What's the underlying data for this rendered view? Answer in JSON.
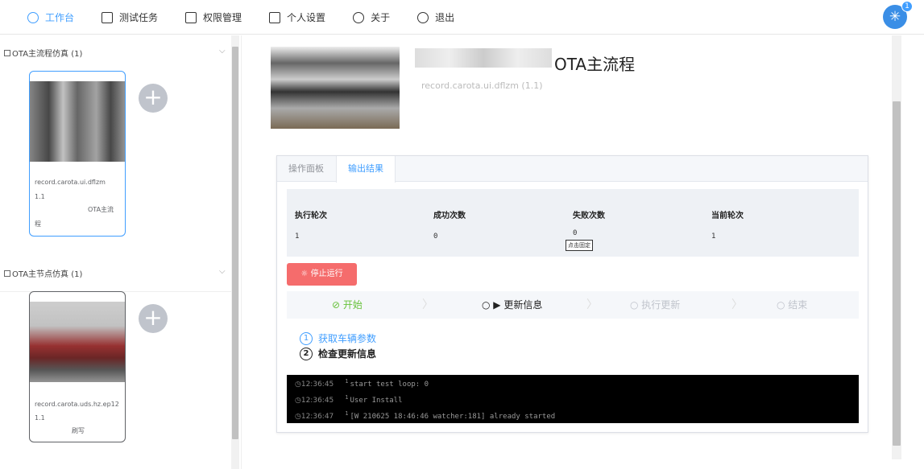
{
  "nav": {
    "items": [
      {
        "label": "工作台"
      },
      {
        "label": "测试任务"
      },
      {
        "label": "权限管理"
      },
      {
        "label": "个人设置"
      },
      {
        "label": "关于"
      },
      {
        "label": "退出"
      }
    ],
    "badge": "1"
  },
  "sidebar": {
    "groups": [
      {
        "title": "OTA主流程仿真 (1)",
        "card": {
          "line1": "record.carota.ui.dflzm",
          "line2": "1.1",
          "line3": "OTA主流",
          "line4": "程"
        }
      },
      {
        "title": "OTA主节点仿真 (1)",
        "card": {
          "line1": "record.carota.uds.hz.ep12",
          "line2": "1.1",
          "line3": "刷写"
        }
      }
    ]
  },
  "main": {
    "title": "OTA主流程",
    "subtitle": "record.carota.ui.dflzm (1.1)",
    "tabs": [
      {
        "label": "操作面板"
      },
      {
        "label": "输出结果"
      }
    ],
    "stats": {
      "headers": [
        "执行轮次",
        "成功次数",
        "失败次数",
        "当前轮次"
      ],
      "values": [
        "1",
        "0",
        "0",
        "1"
      ],
      "tooltip": "点击固定"
    },
    "stop_button": "停止运行",
    "steps": [
      {
        "label": "开始",
        "state": "done"
      },
      {
        "label": "更新信息",
        "state": "current"
      },
      {
        "label": "执行更新",
        "state": "wait"
      },
      {
        "label": "结束",
        "state": "wait"
      }
    ],
    "substeps": [
      {
        "num": "1",
        "label": "获取车辆参数"
      },
      {
        "num": "2",
        "label": "检查更新信息"
      }
    ],
    "log": [
      {
        "time": "12:36:45",
        "n": "1",
        "text": "start test loop: 0"
      },
      {
        "time": "12:36:45",
        "n": "1",
        "text": "User Install"
      },
      {
        "time": "12:36:47",
        "n": "1",
        "text": "[W 210625 18:46:46 watcher:181] already started"
      }
    ]
  },
  "colors": {
    "accent": "#409eff",
    "danger": "#f56c6c",
    "success": "#67c23a"
  }
}
